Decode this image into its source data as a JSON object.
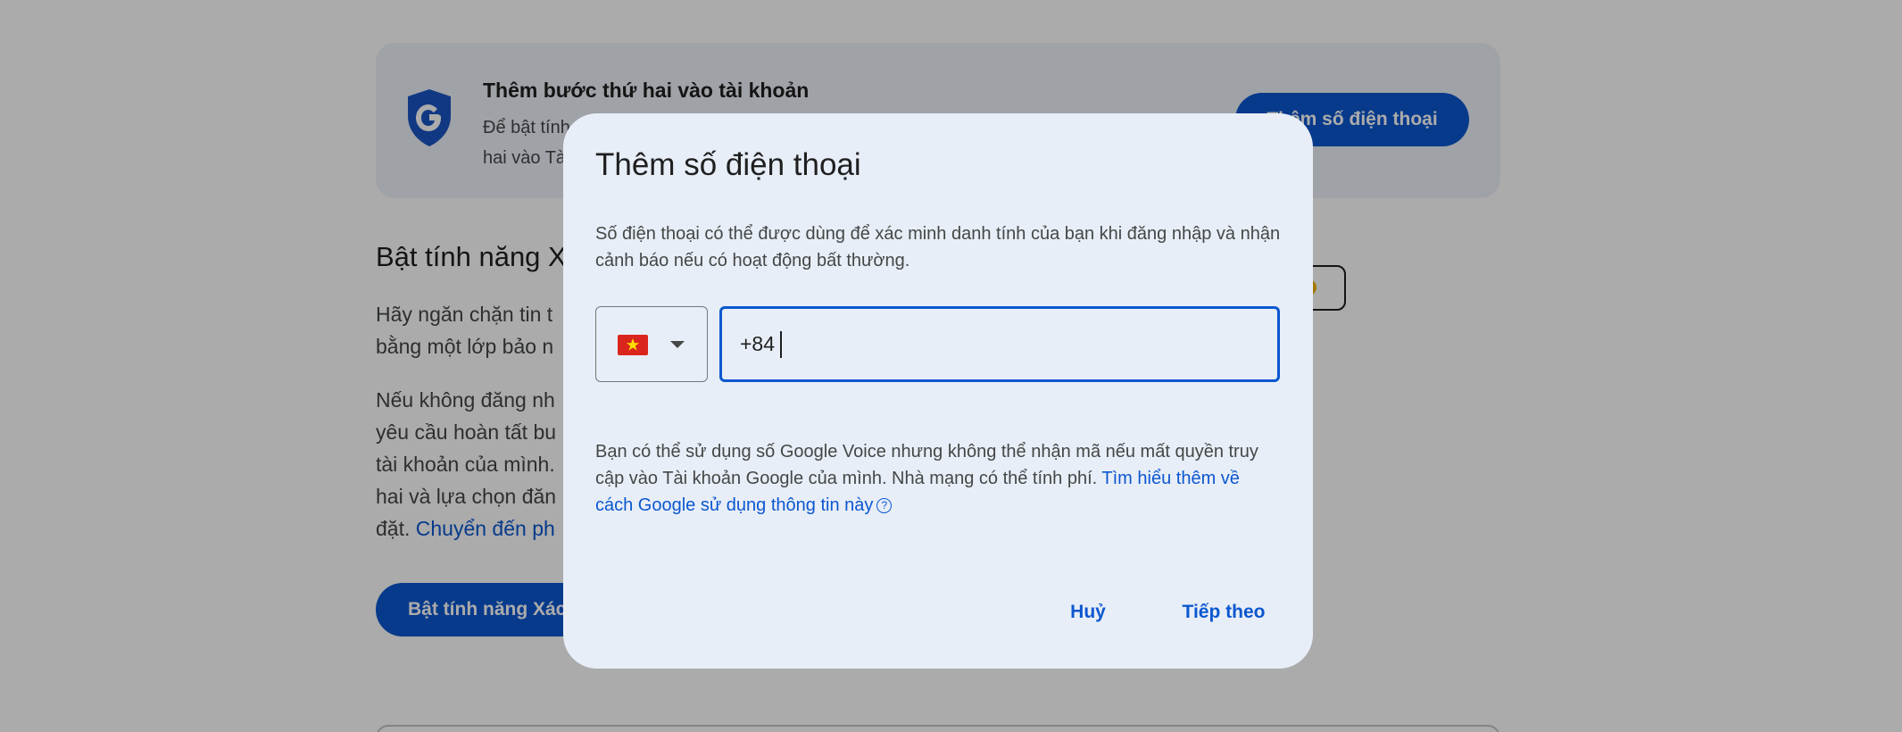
{
  "banner": {
    "title": "Thêm bước thứ hai vào tài khoản",
    "description": "Để bật tính\nhai vào Tà",
    "button_label": "Thêm số điện thoại"
  },
  "section": {
    "title": "Bật tính năng X",
    "paragraph1": "Hãy ngăn chặn tin t\nbằng một lớp bảo n",
    "paragraph2_text": "Nếu không đăng nh\nyêu cầu hoàn tất bu\ntài khoản của mình.\nhai và lựa chọn đăn\nđặt. ",
    "paragraph2_link": "Chuyển đến ph",
    "primary_button_label": "Bật tính năng Xác"
  },
  "colors": {
    "accent": "#0b57d0",
    "dialog_bg": "#e8eef7",
    "scrim": "rgba(0,0,0,0.33)"
  },
  "dialog": {
    "title": "Thêm số điện thoại",
    "description": "Số điện thoại có thể được dùng để xác minh danh tính của bạn khi đăng nhập và nhận cảnh báo nếu có hoạt động bất thường.",
    "country_selected": "VN",
    "country_flag_icon": "vietnam-flag-icon",
    "phone_value": "+84",
    "note_text": "Bạn có thể sử dụng số Google Voice nhưng không thể nhận mã nếu mất quyền truy cập vào Tài khoản Google của mình. Nhà mạng có thể tính phí. ",
    "note_link": "Tìm hiểu thêm về cách Google sử dụng thông tin này",
    "help_icon": "?",
    "cancel_label": "Huỷ",
    "next_label": "Tiếp theo"
  }
}
